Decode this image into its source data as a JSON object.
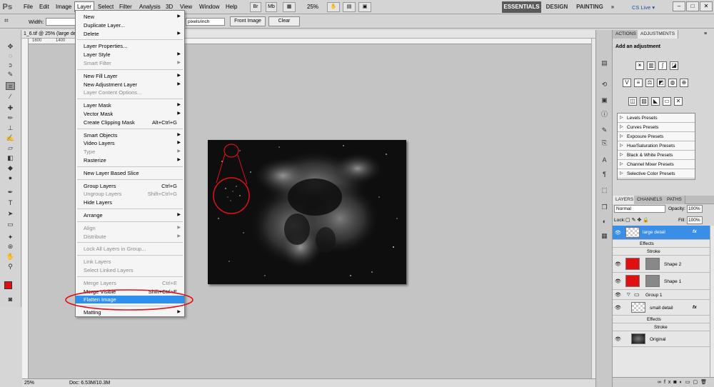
{
  "app": {
    "logo": "Ps"
  },
  "menubar": {
    "items": [
      "File",
      "Edit",
      "Image",
      "Layer",
      "Select",
      "Filter",
      "Analysis",
      "3D",
      "View",
      "Window",
      "Help"
    ],
    "zoom": "25%",
    "workspaces": [
      "ESSENTIALS",
      "DESIGN",
      "PAINTING"
    ],
    "more": "»",
    "cs_live": "CS Live ▾",
    "window_controls": [
      "–",
      "□",
      "✕"
    ]
  },
  "options_bar": {
    "width_label": "Width:",
    "resolution_unit": "pixels/inch",
    "front_image_label": "Front Image",
    "clear_label": "Clear"
  },
  "document": {
    "tab_title": "1_6.tif @ 25% (large de",
    "ruler_marks": [
      "1600",
      "1400",
      "1200"
    ],
    "status_zoom": "25%",
    "status_doc": "Doc: 6.53M/10.3M"
  },
  "layer_menu": {
    "g1": [
      {
        "label": "New",
        "arrow": "▶"
      },
      {
        "label": "Duplicate Layer..."
      },
      {
        "label": "Delete",
        "arrow": "▶"
      }
    ],
    "g2": [
      {
        "label": "Layer Properties..."
      },
      {
        "label": "Layer Style",
        "arrow": "▶"
      },
      {
        "label": "Smart Filter",
        "arrow": "▶",
        "disabled": true
      }
    ],
    "g3": [
      {
        "label": "New Fill Layer",
        "arrow": "▶"
      },
      {
        "label": "New Adjustment Layer",
        "arrow": "▶"
      },
      {
        "label": "Layer Content Options...",
        "disabled": true
      }
    ],
    "g4": [
      {
        "label": "Layer Mask",
        "arrow": "▶"
      },
      {
        "label": "Vector Mask",
        "arrow": "▶"
      },
      {
        "label": "Create Clipping Mask",
        "shortcut": "Alt+Ctrl+G"
      }
    ],
    "g5": [
      {
        "label": "Smart Objects",
        "arrow": "▶"
      },
      {
        "label": "Video Layers",
        "arrow": "▶"
      },
      {
        "label": "Type",
        "arrow": "▶",
        "disabled": true
      },
      {
        "label": "Rasterize",
        "arrow": "▶"
      }
    ],
    "g6": [
      {
        "label": "New Layer Based Slice"
      }
    ],
    "g7": [
      {
        "label": "Group Layers",
        "shortcut": "Ctrl+G"
      },
      {
        "label": "Ungroup Layers",
        "shortcut": "Shift+Ctrl+G",
        "disabled": true
      },
      {
        "label": "Hide Layers"
      }
    ],
    "g8": [
      {
        "label": "Arrange",
        "arrow": "▶"
      }
    ],
    "g9": [
      {
        "label": "Align",
        "arrow": "▶",
        "disabled": true
      },
      {
        "label": "Distribute",
        "arrow": "▶",
        "disabled": true
      }
    ],
    "g10": [
      {
        "label": "Lock All Layers in Group...",
        "disabled": true
      }
    ],
    "g11": [
      {
        "label": "Link Layers",
        "disabled": true
      },
      {
        "label": "Select Linked Layers",
        "disabled": true
      }
    ],
    "g12": [
      {
        "label": "Merge Layers",
        "shortcut": "Ctrl+E",
        "disabled": true
      },
      {
        "label": "Merge Visible",
        "shortcut": "Shift+Ctrl+E"
      },
      {
        "label": "Flatten Image",
        "highlighted": true
      }
    ],
    "g13": [
      {
        "label": "Matting",
        "arrow": "▶"
      }
    ]
  },
  "adjustments_panel": {
    "tabs": [
      "ACTIONS",
      "ADJUSTMENTS"
    ],
    "heading": "Add an adjustment",
    "presets": [
      "Levels Presets",
      "Curves Presets",
      "Exposure Presets",
      "Hue/Saturation Presets",
      "Black & White Presets",
      "Channel Mixer Presets",
      "Selective Color Presets"
    ]
  },
  "layers_panel": {
    "tabs": [
      "LAYERS",
      "CHANNELS",
      "PATHS"
    ],
    "blend_mode": "Normal",
    "opacity_label": "Opacity:",
    "opacity": "100%",
    "lock_label": "Lock:",
    "fill_label": "Fill:",
    "fill": "100%",
    "layers": {
      "large_detail": "large detail",
      "effects1": "Effects",
      "stroke1": "Stroke",
      "shape2": "Shape 2",
      "shape1": "Shape 1",
      "group1": "Group 1",
      "small_detail": "small detail",
      "effects2": "Effects",
      "stroke2": "Stroke",
      "original": "Original"
    },
    "fx": "fx"
  },
  "colors": {
    "highlight": "#2d8ff0",
    "annotation_red": "#e0101a",
    "foreground_swatch": "#e01010"
  }
}
